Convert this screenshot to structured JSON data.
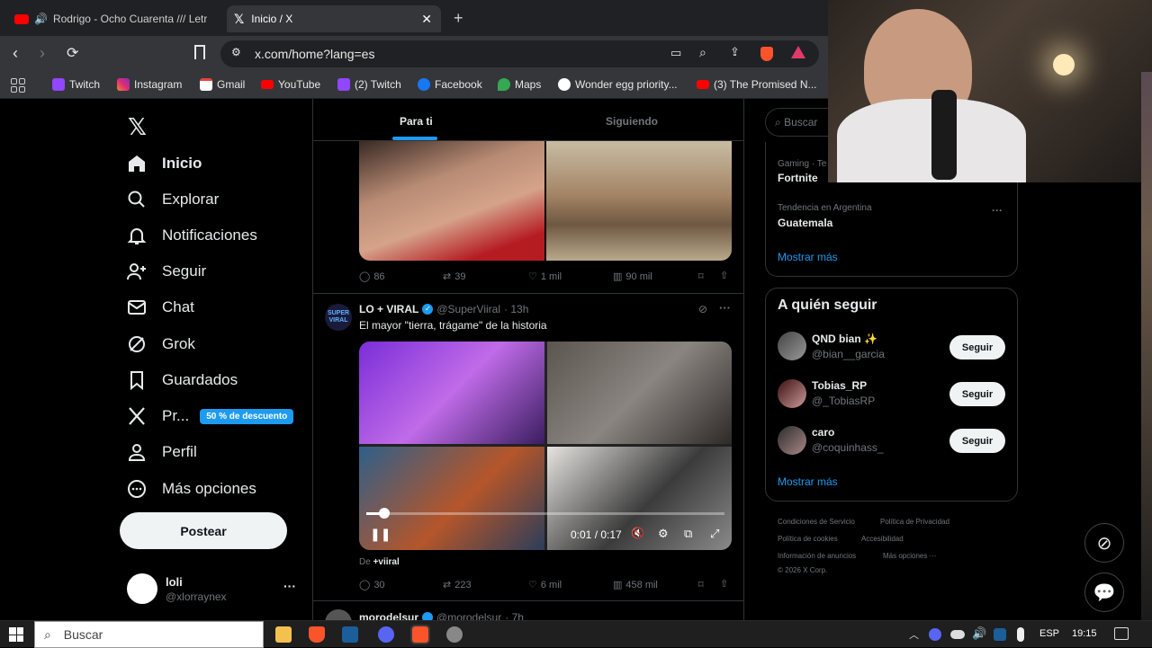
{
  "browser": {
    "tabs": [
      {
        "title": "Rodrigo - Ocho Cuarenta /// Letr",
        "active": false
      },
      {
        "title": "Inicio / X",
        "active": true
      }
    ],
    "url": "x.com/home?lang=es",
    "bookmarks": [
      "Twitch",
      "Instagram",
      "Gmail",
      "YouTube",
      "(2) Twitch",
      "Facebook",
      "Maps",
      "Wonder egg priority...",
      "(3) The Promised N..."
    ]
  },
  "nav": {
    "items": [
      "Inicio",
      "Explorar",
      "Notificaciones",
      "Seguir",
      "Chat",
      "Grok",
      "Guardados",
      "Pr...",
      "Perfil",
      "Más opciones"
    ],
    "premium_badge": "50 % de descuento",
    "post": "Postear",
    "account": {
      "name": "loli",
      "handle": "@xlorraynex"
    }
  },
  "feed": {
    "tabs": [
      "Para ti",
      "Siguiendo"
    ],
    "tweet1": {
      "replies": "86",
      "retweets": "39",
      "likes": "1 mil",
      "views": "90 mil"
    },
    "tweet2": {
      "name": "LO + VIRAL",
      "handle": "@SuperViiral",
      "time": "· 13h",
      "text": "El mayor \"tierra, trágame\" de la historia",
      "video_time": "0:01 / 0:17",
      "from_prefix": "De ",
      "from_account": "+viiral",
      "replies": "30",
      "retweets": "223",
      "likes": "6 mil",
      "views": "458 mil"
    },
    "tweet3": {
      "name": "morodelsur",
      "handle": "@morodelsur",
      "time": "· 7h"
    }
  },
  "right": {
    "search_placeholder": "Buscar",
    "trends": [
      {
        "meta": "Gaming · Te",
        "name": "Fortnite"
      },
      {
        "meta": "Tendencia en Argentina",
        "name": "Guatemala"
      }
    ],
    "show_more": "Mostrar más",
    "who_to_follow": "A quién seguir",
    "follow": [
      {
        "name": "QND bian ✨",
        "handle": "@bian__garcia"
      },
      {
        "name": "Tobias_RP",
        "handle": "@_TobiasRP"
      },
      {
        "name": "caro",
        "handle": "@coquinhass_"
      }
    ],
    "follow_label": "Seguir",
    "footer": [
      "Condiciones de Servicio",
      "Política de Privacidad",
      "Política de cookies",
      "Accesibilidad",
      "Información de anuncios",
      "Más opciones ···",
      "© 2026 X Corp."
    ]
  },
  "taskbar": {
    "search": "Buscar",
    "lang": "ESP",
    "time": "19:15"
  },
  "colors": {
    "accent": "#1d9bf0",
    "bg": "#000000",
    "border": "#2f3336"
  }
}
